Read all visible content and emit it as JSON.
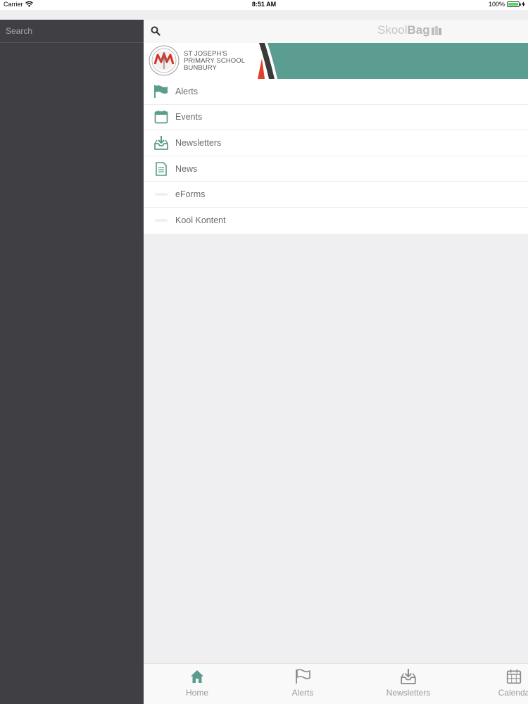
{
  "status": {
    "carrier": "Carrier",
    "time": "8:51 AM",
    "battery": "100%"
  },
  "sidebar": {
    "search_placeholder": "Search"
  },
  "header": {
    "brand_light": "Skool",
    "brand_bold": "Bag"
  },
  "banner": {
    "line1": "ST JOSEPH'S",
    "line2": "PRIMARY SCHOOL",
    "line3": "BUNBURY"
  },
  "menu": {
    "items": [
      {
        "label": "Alerts",
        "icon": "flag-icon"
      },
      {
        "label": "Events",
        "icon": "calendar-icon"
      },
      {
        "label": "Newsletters",
        "icon": "inbox-download-icon"
      },
      {
        "label": "News",
        "icon": "document-icon"
      },
      {
        "label": "eForms",
        "icon": "placeholder-icon"
      },
      {
        "label": "Kool Kontent",
        "icon": "placeholder-icon"
      }
    ]
  },
  "tabs": [
    {
      "label": "Home",
      "icon": "home-icon"
    },
    {
      "label": "Alerts",
      "icon": "flag-icon"
    },
    {
      "label": "Newsletters",
      "icon": "inbox-download-icon"
    },
    {
      "label": "Calenda",
      "icon": "calendar-icon"
    }
  ],
  "colors": {
    "accent": "#5c9c8c",
    "sidebar": "#404044",
    "banner_teal": "#5b9e91",
    "banner_red": "#e0402c"
  }
}
